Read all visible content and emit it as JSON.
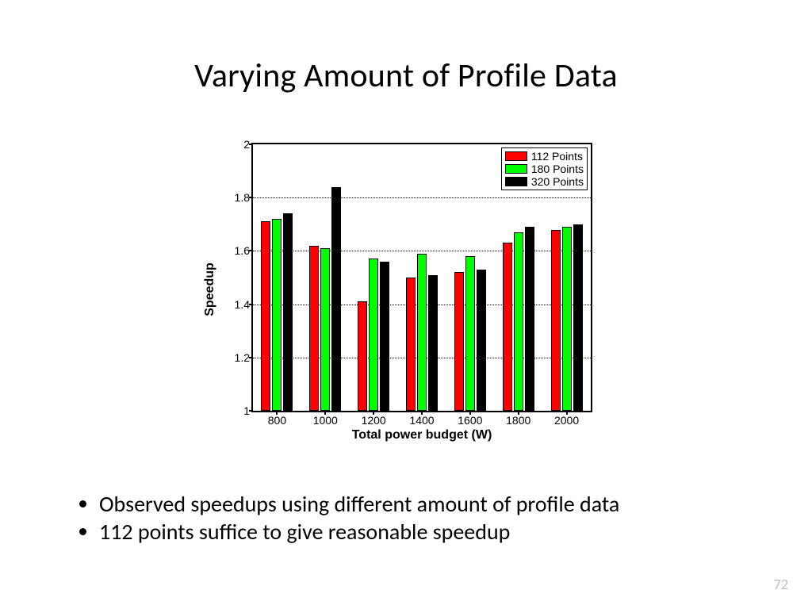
{
  "title": "Varying Amount of Profile Data",
  "bullets": [
    "Observed speedups using different amount of profile data",
    "112 points suffice to give reasonable speedup"
  ],
  "page_number": "72",
  "chart_data": {
    "type": "bar",
    "xlabel": "Total power budget (W)",
    "ylabel": "Speedup",
    "ylim": [
      1.0,
      2.0
    ],
    "yticks": [
      1.0,
      1.2,
      1.4,
      1.6,
      1.8,
      2.0
    ],
    "categories": [
      "800",
      "1000",
      "1200",
      "1400",
      "1600",
      "1800",
      "2000"
    ],
    "series": [
      {
        "name": "112 Points",
        "color": "#ff0000",
        "values": [
          1.71,
          1.62,
          1.41,
          1.5,
          1.52,
          1.63,
          1.68
        ]
      },
      {
        "name": "180 Points",
        "color": "#00ff00",
        "values": [
          1.72,
          1.61,
          1.57,
          1.59,
          1.58,
          1.67,
          1.69
        ]
      },
      {
        "name": "320 Points",
        "color": "#000000",
        "values": [
          1.74,
          1.84,
          1.56,
          1.51,
          1.53,
          1.69,
          1.7
        ]
      }
    ],
    "grid": "horizontal-dotted",
    "legend_position": "top-right"
  }
}
